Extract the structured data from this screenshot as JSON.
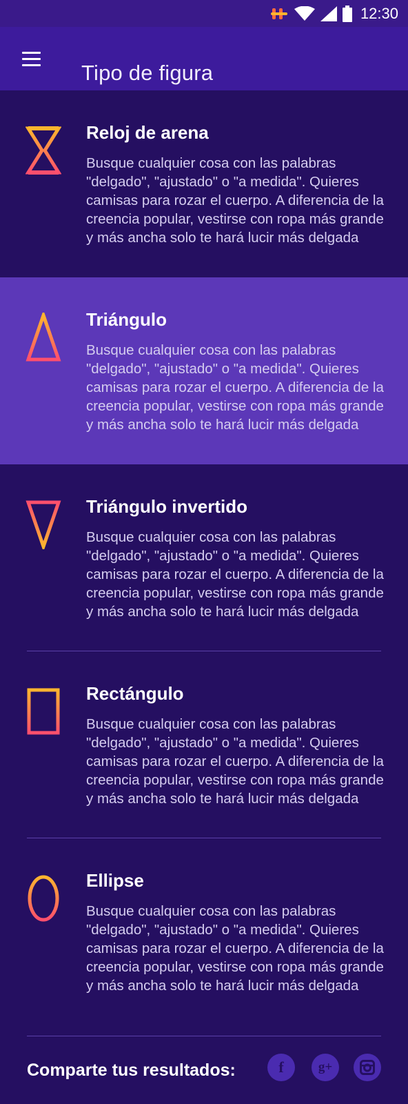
{
  "status_bar": {
    "time": "12:30",
    "icons": [
      "app-notification-icon",
      "wifi-icon",
      "signal-icon",
      "battery-icon"
    ]
  },
  "app_bar": {
    "menu_icon": "hamburger-menu-icon",
    "title": "Tipo de figura"
  },
  "colors": {
    "background": "#250f61",
    "app_bar": "#3d1b9c",
    "selected_item": "#5c38b8",
    "icon_gradient_start": "#ff4f6d",
    "icon_gradient_end": "#ffb52e"
  },
  "shapes": [
    {
      "icon": "hourglass-icon",
      "title": "Reloj de arena",
      "description": "Busque cualquier cosa con las palabras \"delgado\", \"ajustado\" o \"a medida\". Quieres camisas para rozar el cuerpo. A diferencia de la creencia popular, vestirse con ropa más grande y más ancha solo te hará lucir más delgada",
      "selected": false
    },
    {
      "icon": "triangle-icon",
      "title": "Triángulo",
      "description": "Busque cualquier cosa con las palabras \"delgado\", \"ajustado\" o \"a medida\". Quieres camisas para rozar el cuerpo. A diferencia de la creencia popular, vestirse con ropa más grande y más ancha solo te hará lucir más delgada",
      "selected": true
    },
    {
      "icon": "inverted-triangle-icon",
      "title": "Triángulo invertido",
      "description": "Busque cualquier cosa con las palabras \"delgado\", \"ajustado\" o \"a medida\". Quieres camisas para rozar el cuerpo. A diferencia de la creencia popular, vestirse con ropa más grande y más ancha solo te hará lucir más delgada",
      "selected": false
    },
    {
      "icon": "rectangle-icon",
      "title": "Rectángulo",
      "description": "Busque cualquier cosa con las palabras \"delgado\", \"ajustado\" o \"a medida\". Quieres camisas para rozar el cuerpo. A diferencia de la creencia popular, vestirse con ropa más grande y más ancha solo te hará lucir más delgada",
      "selected": false
    },
    {
      "icon": "ellipse-icon",
      "title": "Ellipse",
      "description": "Busque cualquier cosa con las palabras \"delgado\", \"ajustado\" o \"a medida\". Quieres camisas para rozar el cuerpo. A diferencia de la creencia popular, vestirse con ropa más grande y más ancha solo te hará lucir más delgada",
      "selected": false
    }
  ],
  "footer": {
    "share_label": "Comparte tus resultados:",
    "social": [
      {
        "icon": "facebook-icon",
        "glyph": "f"
      },
      {
        "icon": "google-plus-icon",
        "glyph": "g+"
      },
      {
        "icon": "instagram-icon",
        "glyph": ""
      }
    ]
  }
}
